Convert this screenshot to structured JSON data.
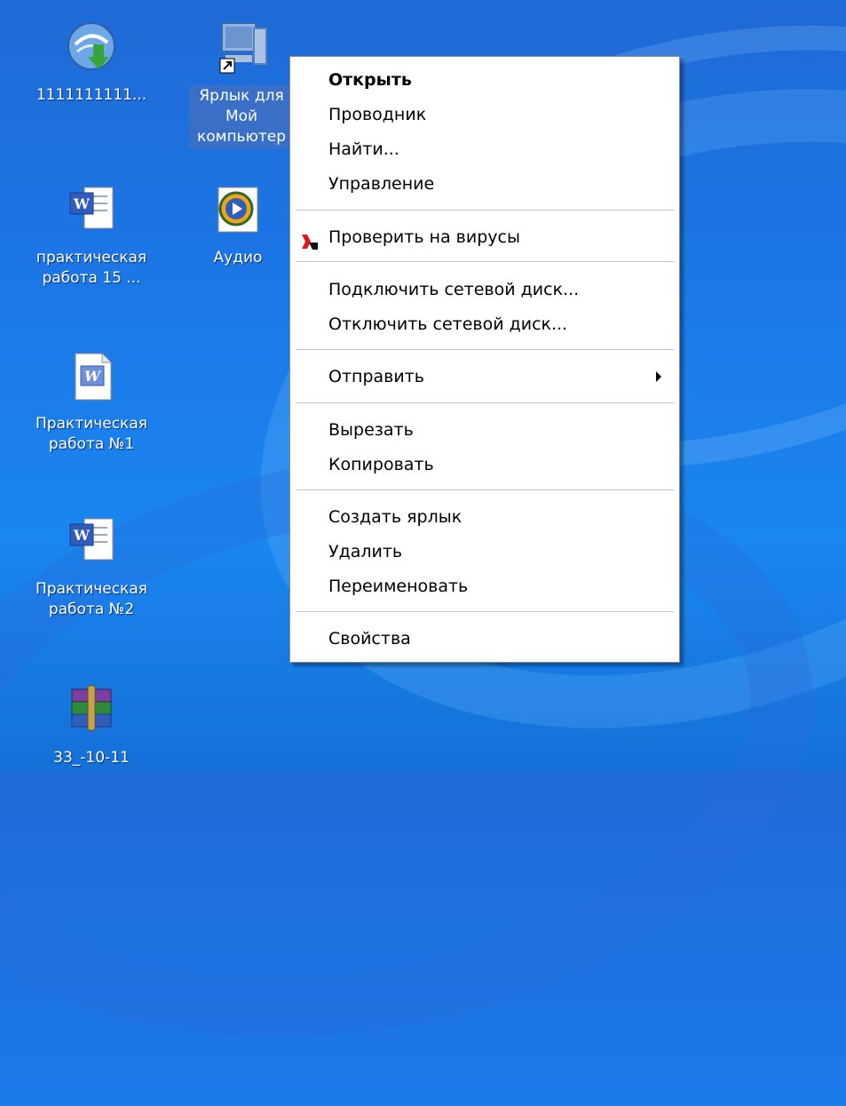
{
  "desktop": {
    "icons": [
      {
        "label": "1111111111..."
      },
      {
        "label": "Ярлык для Мой компьютер"
      },
      {
        "label": "практическая работа 15 ..."
      },
      {
        "label": "Аудио"
      },
      {
        "label": "Практическая работа №1"
      },
      {
        "label": "Практическая работа №2"
      },
      {
        "label": "33_-10-11"
      }
    ]
  },
  "context_menu": {
    "items": [
      {
        "label": "Открыть"
      },
      {
        "label": "Проводник"
      },
      {
        "label": "Найти..."
      },
      {
        "label": "Управление"
      },
      {
        "label": "Проверить на вирусы"
      },
      {
        "label": "Подключить сетевой диск..."
      },
      {
        "label": "Отключить сетевой диск..."
      },
      {
        "label": "Отправить"
      },
      {
        "label": "Вырезать"
      },
      {
        "label": "Копировать"
      },
      {
        "label": "Создать ярлык"
      },
      {
        "label": "Удалить"
      },
      {
        "label": "Переименовать"
      },
      {
        "label": "Свойства"
      }
    ]
  },
  "icons": {
    "kaspersky": "kaspersky-icon",
    "submenu_arrow": "submenu-arrow-icon"
  },
  "colors": {
    "desktop_blue": "#1c78e8",
    "selection": "#3a6fc7",
    "menu_bg": "#ffffff",
    "separator": "#c5c5c5"
  }
}
